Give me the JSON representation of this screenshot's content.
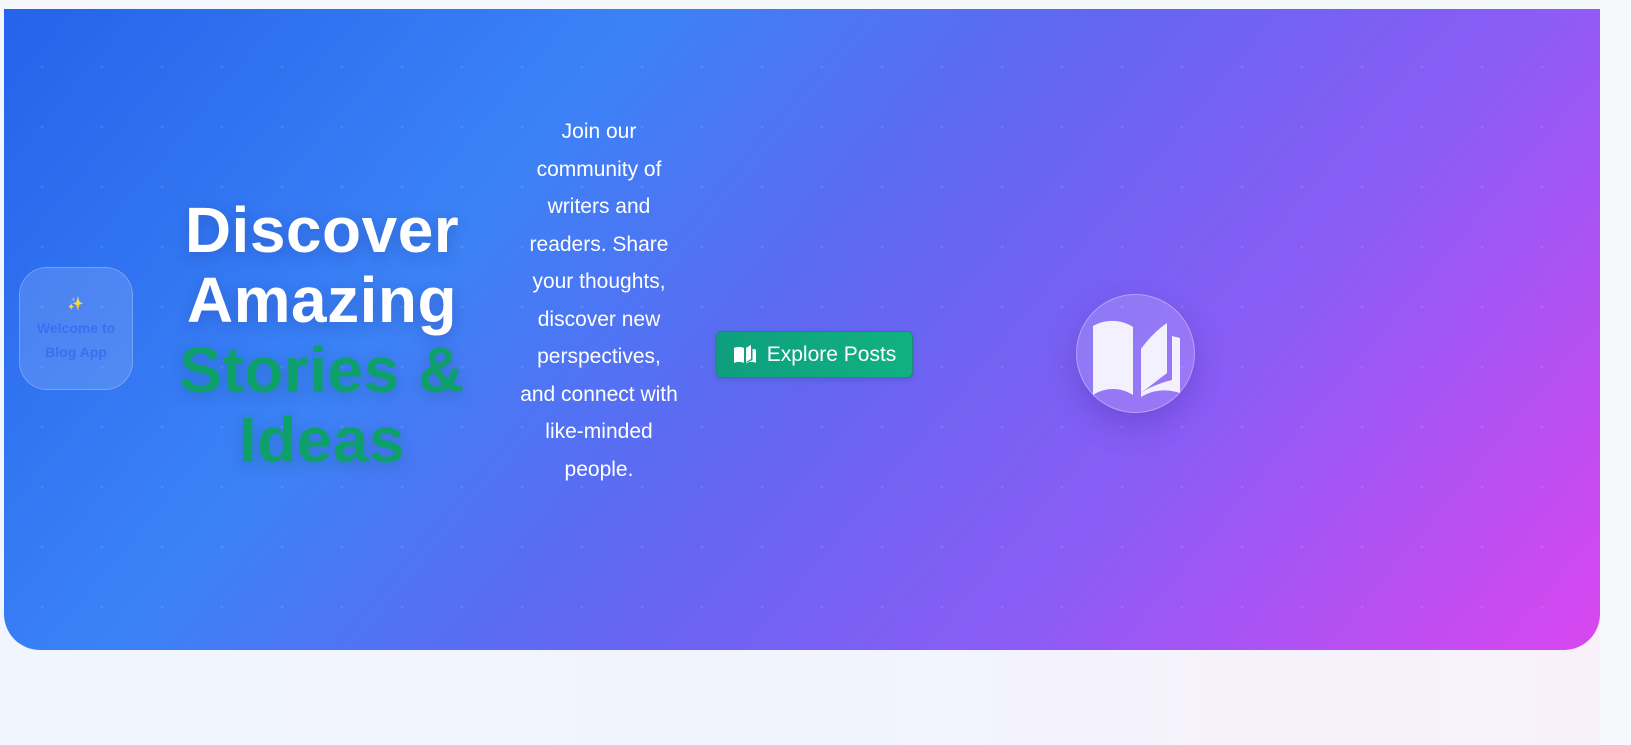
{
  "hero": {
    "badge": {
      "icon": "sparkles-icon",
      "icon_glyph": "✨",
      "text": "Welcome to Blog App"
    },
    "headline": {
      "line1": "Discover",
      "line2": "Amazing",
      "line3": "Stories &",
      "line4": "Ideas"
    },
    "description": "Join our community of writers and readers. Share your thoughts, discover new perspectives, and connect with like-minded people.",
    "cta": {
      "icon": "book-open-icon",
      "label": "Explore Posts"
    },
    "illustration": {
      "icon": "open-book-icon"
    }
  },
  "colors": {
    "gradient_start": "#2563eb",
    "gradient_mid": "#8b5cf6",
    "gradient_end": "#d946ef",
    "accent_green": "#0ea06a",
    "button_bg": "#10a37f",
    "page_bg": "#f1f6fe"
  }
}
